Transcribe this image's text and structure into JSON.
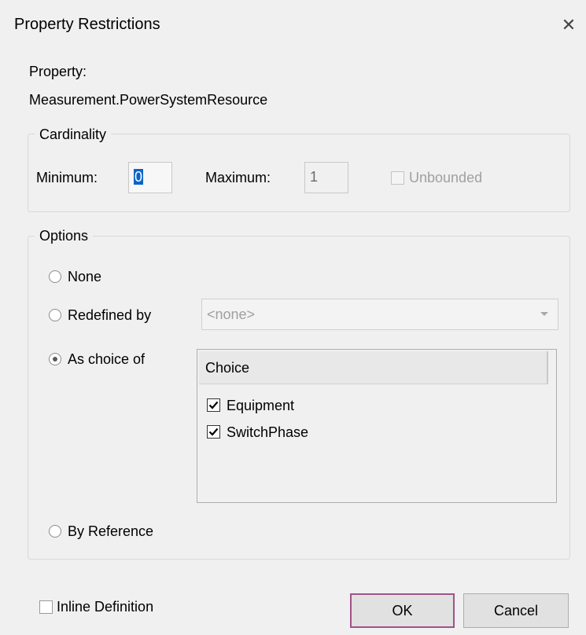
{
  "dialog": {
    "title": "Property Restrictions",
    "close_glyph": "✕"
  },
  "property": {
    "label": "Property:",
    "value": "Measurement.PowerSystemResource"
  },
  "cardinality": {
    "legend": "Cardinality",
    "minimum_label": "Minimum:",
    "minimum_value": "0",
    "maximum_label": "Maximum:",
    "maximum_value": "1",
    "unbounded_label": "Unbounded",
    "unbounded_checked": false
  },
  "options": {
    "legend": "Options",
    "none_label": "None",
    "redefined_label": "Redefined by",
    "redefined_value": "<none>",
    "choice_label": "As choice of",
    "choice_selected": true,
    "reference_label": "By Reference",
    "choice_list": {
      "header": "Choice",
      "items": [
        {
          "label": "Equipment",
          "checked": true
        },
        {
          "label": "SwitchPhase",
          "checked": true
        }
      ]
    }
  },
  "footer": {
    "inline_definition_label": "Inline Definition",
    "inline_definition_checked": false,
    "ok_label": "OK",
    "cancel_label": "Cancel"
  }
}
